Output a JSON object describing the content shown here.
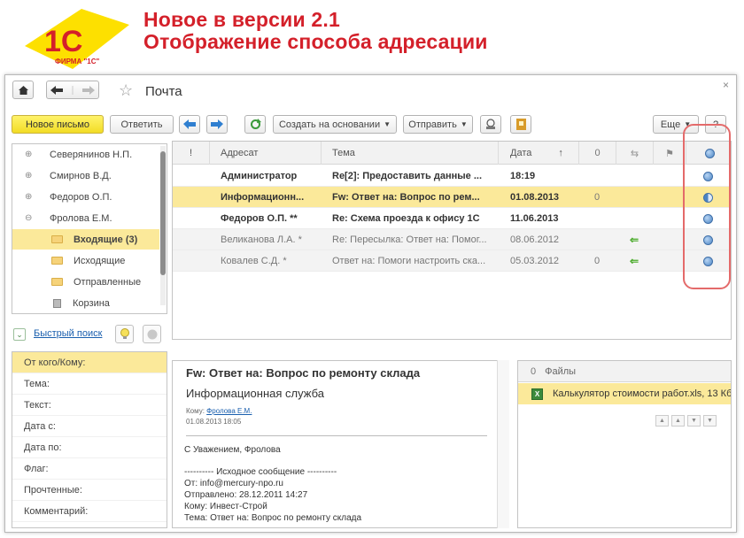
{
  "slide": {
    "title_line1": "Новое в версии 2.1",
    "title_line2": "Отображение способа адресации",
    "logo_text": "1С",
    "logo_caption": "ФИРМА \"1С\""
  },
  "window": {
    "title": "Почта",
    "close_glyph": "×"
  },
  "toolbar": {
    "new_mail": "Новое письмо",
    "reply": "Ответить",
    "create_based": "Создать на основании",
    "send": "Отправить",
    "more": "Еще",
    "help": "?"
  },
  "tree": {
    "items": [
      {
        "label": "Северянинов Н.П.",
        "expander": "⊕",
        "selected": false
      },
      {
        "label": "Смирнов В.Д.",
        "expander": "⊕",
        "selected": false
      },
      {
        "label": "Федоров О.П.",
        "expander": "⊕",
        "selected": false
      },
      {
        "label": "Фролова Е.М.",
        "expander": "⊖",
        "selected": false
      },
      {
        "label": "Входящие (3)",
        "expander": "",
        "selected": true
      },
      {
        "label": "Исходящие",
        "expander": "",
        "selected": false
      },
      {
        "label": "Отправленные",
        "expander": "",
        "selected": false
      },
      {
        "label": "Корзина",
        "expander": "",
        "selected": false
      }
    ]
  },
  "quick_search": {
    "label": "Быстрый поиск",
    "toggle_glyph": "⌄"
  },
  "filters": [
    "От кого/Кому:",
    "Тема:",
    "Текст:",
    "Дата с:",
    "Дата по:",
    "Флаг:",
    "Прочтенные:",
    "Комментарий:"
  ],
  "grid": {
    "headers": {
      "importance": "!",
      "addressee": "Адресат",
      "subject": "Тема",
      "date": "Дата",
      "sort_arrow": "↑"
    },
    "rows": [
      {
        "addressee": "Администратор",
        "subject": "Re[2]: Предоставить данные ...",
        "date": "18:19",
        "attachment": "",
        "replied": "",
        "addressing": "full",
        "unread": true,
        "highlight": false
      },
      {
        "addressee": "Информационн...",
        "subject": "Fw: Ответ на: Вопрос по рем...",
        "date": "01.08.2013",
        "attachment": "0",
        "replied": "",
        "addressing": "half",
        "unread": true,
        "highlight": true
      },
      {
        "addressee": "Федоров О.П. **",
        "subject": "Re: Схема проезда к офису 1С",
        "date": "11.06.2013",
        "attachment": "",
        "replied": "",
        "addressing": "full",
        "unread": true,
        "highlight": false
      },
      {
        "addressee": "Великанова Л.А. *",
        "subject": "Re: Пересылка: Ответ на: Помог...",
        "date": "08.06.2012",
        "attachment": "",
        "replied": "⇐",
        "addressing": "full",
        "unread": false,
        "highlight": false
      },
      {
        "addressee": "Ковалев С.Д. *",
        "subject": "Ответ на: Помоги настроить ска...",
        "date": "05.03.2012",
        "attachment": "0",
        "replied": "⇐",
        "addressing": "full",
        "unread": false,
        "highlight": false
      }
    ]
  },
  "preview": {
    "subject": "Fw: Ответ на: Вопрос по ремонту склада",
    "from_name": "Информационная служба",
    "to_label": "Кому:",
    "to_value": "Фролова Е.М.",
    "datetime": "01.08.2013 18:05",
    "lines": [
      "С Уважением, Фролова",
      "---------- Исходное сообщение ----------",
      "От: info@mercury-npo.ru",
      "Отправлено: 28.12.2011 14:27",
      "Кому: Инвест-Строй",
      "Тема: Ответ на: Вопрос по ремонту склада"
    ]
  },
  "files": {
    "header": "Файлы",
    "items": [
      "Калькулятор стоимости работ.xls, 13 Кб"
    ]
  }
}
